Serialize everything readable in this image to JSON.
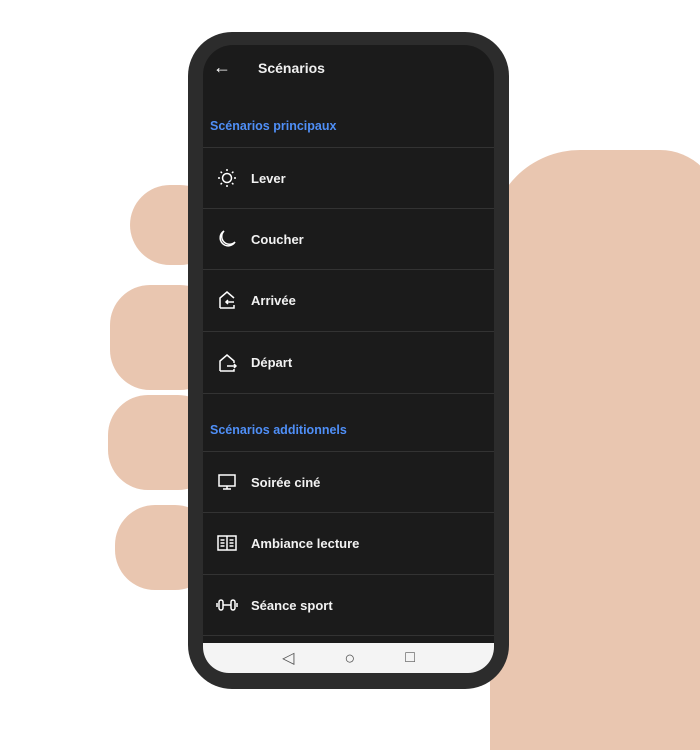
{
  "header": {
    "back_icon": "arrow-left-icon",
    "title": "Scénarios"
  },
  "sections": [
    {
      "title": "Scénarios principaux",
      "items": [
        {
          "label": "Lever",
          "icon": "sun-icon"
        },
        {
          "label": "Coucher",
          "icon": "moon-icon"
        },
        {
          "label": "Arrivée",
          "icon": "home-enter-icon"
        },
        {
          "label": "Départ",
          "icon": "home-exit-icon"
        }
      ]
    },
    {
      "title": "Scénarios additionnels",
      "items": [
        {
          "label": "Soirée ciné",
          "icon": "monitor-icon"
        },
        {
          "label": "Ambiance lecture",
          "icon": "book-icon"
        },
        {
          "label": "Séance sport",
          "icon": "dumbbell-icon"
        }
      ]
    }
  ],
  "navbar": {
    "back": "◁",
    "home": "○",
    "recents": "□"
  },
  "colors": {
    "accent": "#4f8ff7",
    "background": "#1b1b1b"
  }
}
